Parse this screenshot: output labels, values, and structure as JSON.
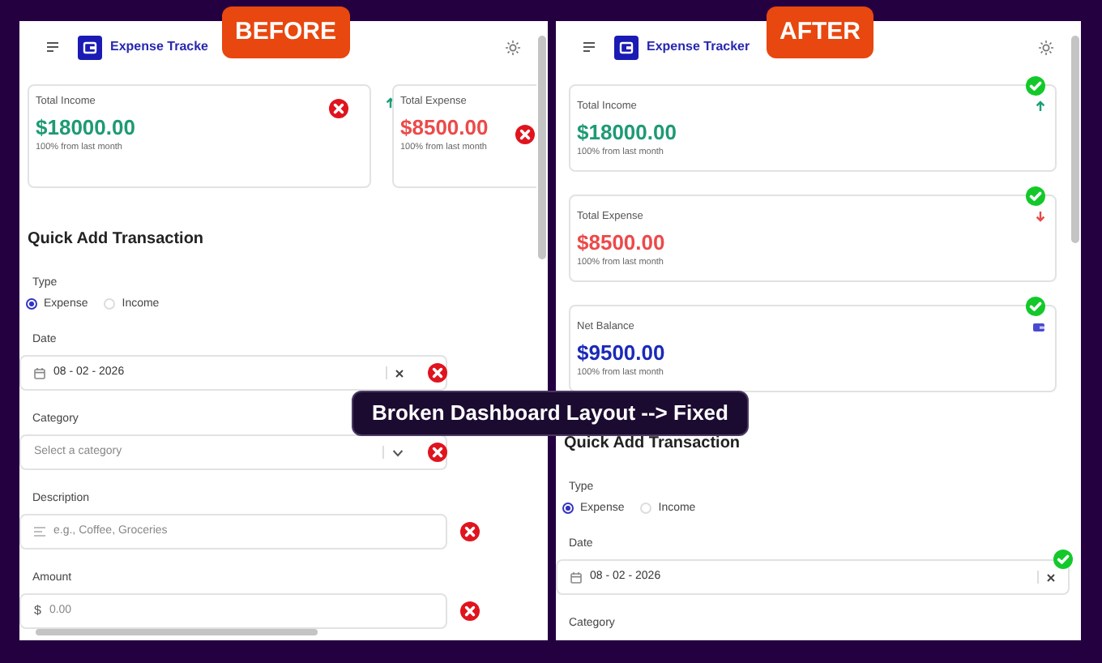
{
  "panels": [
    {
      "badge": "BEFORE",
      "broken": true,
      "app_title": "Expense Tracke",
      "cards": [
        {
          "label": "Total Income",
          "amount": "$18000.00",
          "note": "100% from last month",
          "kind": "income",
          "valid": false
        },
        {
          "label": "Total Expense",
          "amount": "$8500.00",
          "note": "100% from last month",
          "kind": "expense",
          "valid": false
        }
      ],
      "form": {
        "title": "Quick Add Transaction",
        "type_label": "Type",
        "options": [
          {
            "label": "Expense",
            "selected": true
          },
          {
            "label": "Income",
            "selected": false
          }
        ],
        "fields": [
          {
            "label": "Date",
            "kind": "date",
            "value": "08 - 02 - 2026",
            "valid": false
          },
          {
            "label": "Category",
            "kind": "select",
            "placeholder": "Select a category",
            "valid": false
          },
          {
            "label": "Description",
            "kind": "text",
            "placeholder": "e.g., Coffee, Groceries",
            "valid": false
          },
          {
            "label": "Amount",
            "kind": "amount",
            "prefix": "$",
            "placeholder": "0.00",
            "valid": false
          }
        ]
      }
    },
    {
      "badge": "AFTER",
      "broken": false,
      "app_title": "Expense Tracker",
      "cards": [
        {
          "label": "Total Income",
          "amount": "$18000.00",
          "note": "100% from last month",
          "kind": "income",
          "valid": true
        },
        {
          "label": "Total Expense",
          "amount": "$8500.00",
          "note": "100% from last month",
          "kind": "expense",
          "valid": true
        },
        {
          "label": "Net Balance",
          "amount": "$9500.00",
          "note": "100% from last month",
          "kind": "balance",
          "valid": true
        }
      ],
      "form": {
        "title": "Quick Add Transaction",
        "type_label": "Type",
        "options": [
          {
            "label": "Expense",
            "selected": true
          },
          {
            "label": "Income",
            "selected": false
          }
        ],
        "fields": [
          {
            "label": "Date",
            "kind": "date",
            "value": "08 - 02 - 2026",
            "valid": true
          },
          {
            "label": "Category"
          }
        ]
      }
    }
  ],
  "banner": "Broken Dashboard Layout --> Fixed"
}
